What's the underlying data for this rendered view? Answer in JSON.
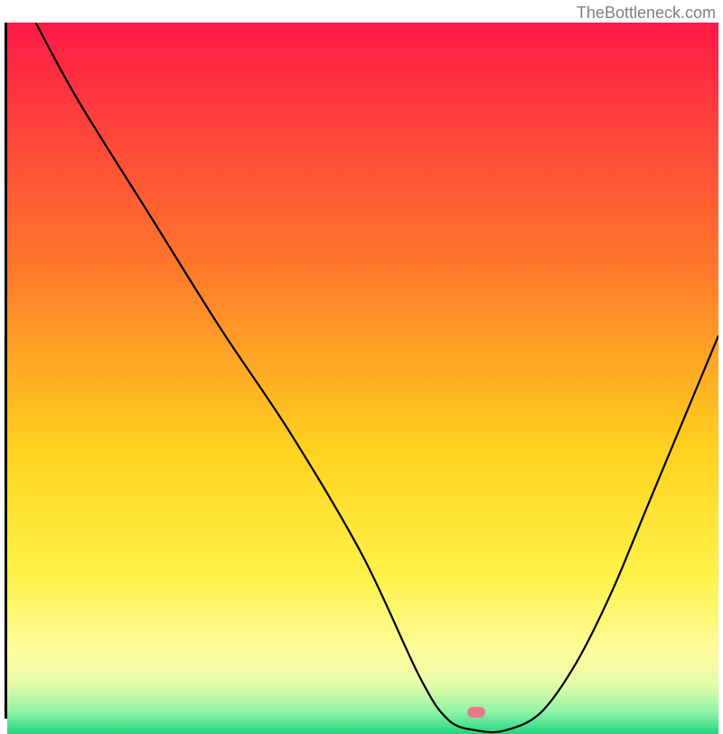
{
  "watermark": "TheBottleneck.com",
  "chart_data": {
    "type": "line",
    "title": "",
    "xlabel": "",
    "ylabel": "",
    "xlim": [
      0,
      100
    ],
    "ylim": [
      0,
      100
    ],
    "series": [
      {
        "name": "bottleneck-curve",
        "x": [
          4,
          10,
          20,
          30,
          40,
          50,
          58,
          62,
          66,
          70,
          75,
          80,
          85,
          90,
          95,
          100
        ],
        "values": [
          100,
          89,
          73,
          57,
          42,
          25,
          8,
          2,
          0.5,
          0.5,
          3,
          10,
          20,
          32,
          44,
          56
        ]
      }
    ],
    "marker": {
      "name": "optimal-point",
      "x": 66,
      "y": 0.5
    },
    "gradient_stops": [
      {
        "pos": 0.0,
        "color": "#ff1a47"
      },
      {
        "pos": 0.35,
        "color": "#ff7a2a"
      },
      {
        "pos": 0.6,
        "color": "#ffd21f"
      },
      {
        "pos": 0.78,
        "color": "#fff24a"
      },
      {
        "pos": 0.88,
        "color": "#fffb9a"
      },
      {
        "pos": 0.93,
        "color": "#e5fca8"
      },
      {
        "pos": 0.97,
        "color": "#8cf2a6"
      },
      {
        "pos": 1.0,
        "color": "#1fd67d"
      }
    ]
  }
}
